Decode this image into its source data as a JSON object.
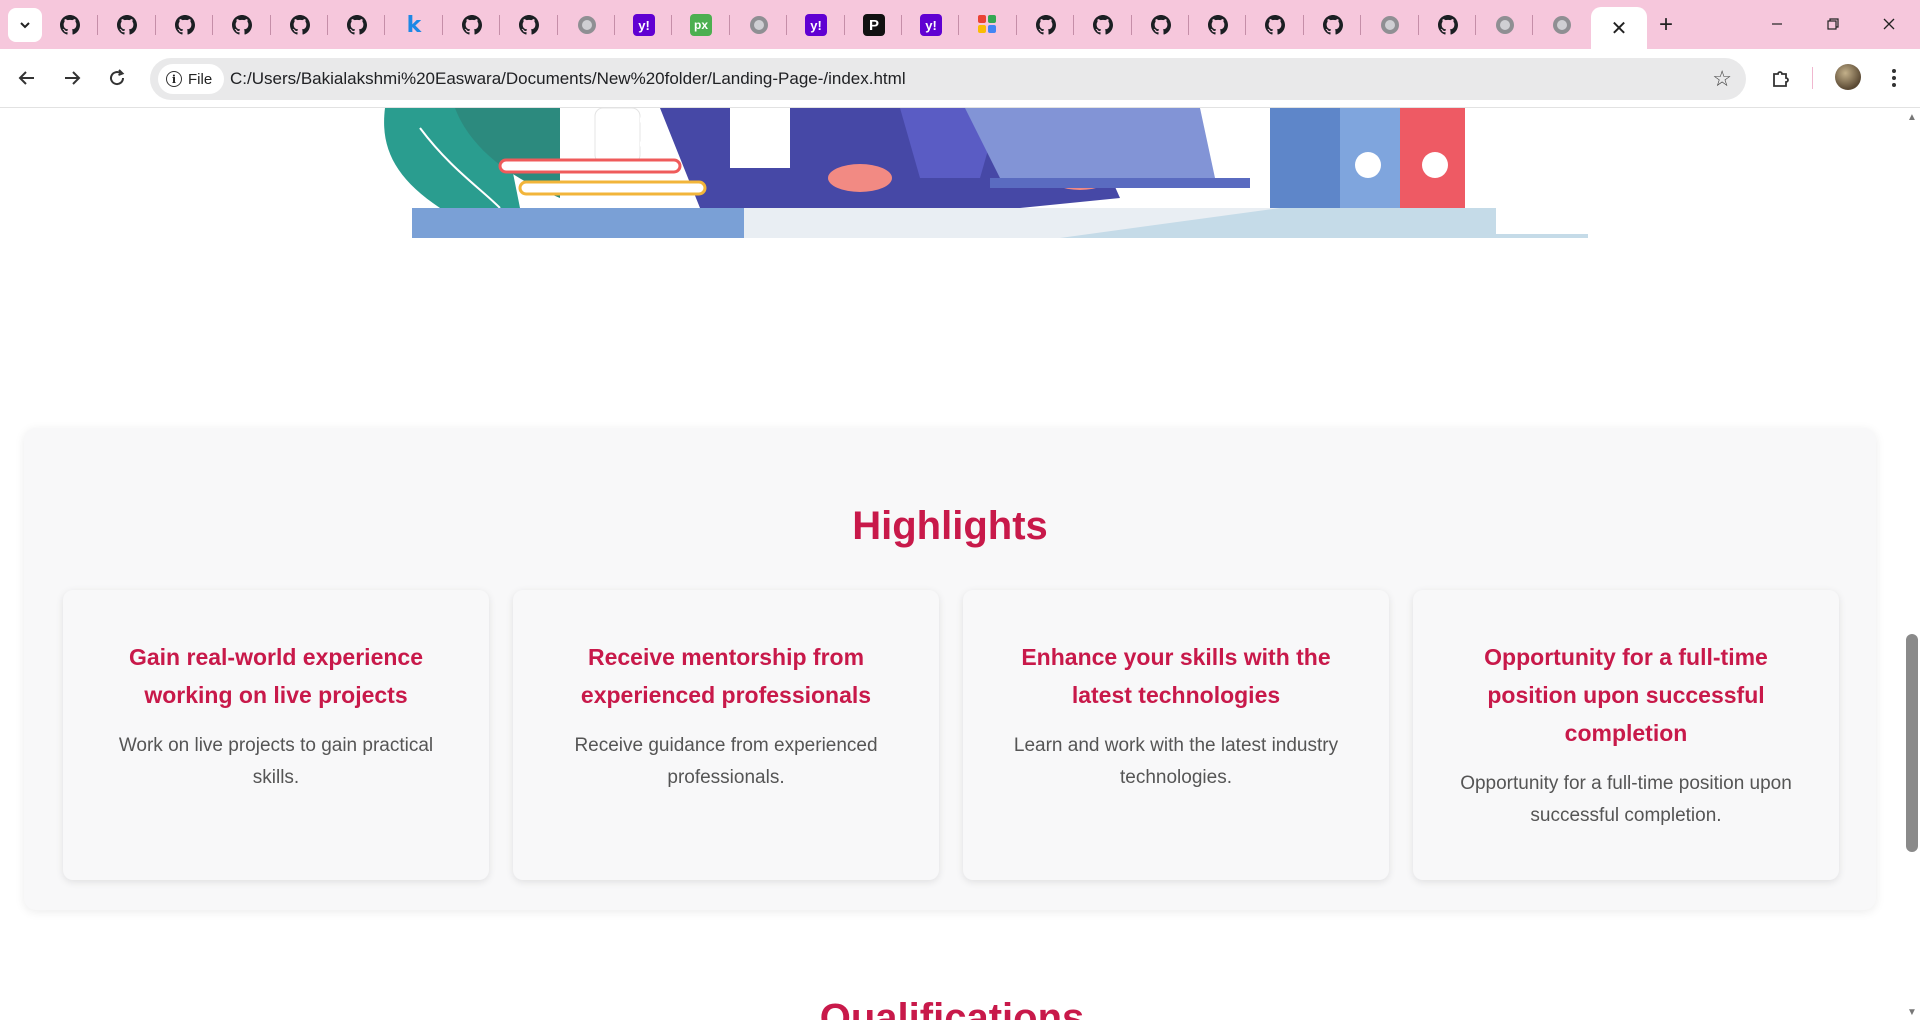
{
  "browser": {
    "tabs": [
      {
        "icon": "github-icon"
      },
      {
        "icon": "github-icon"
      },
      {
        "icon": "github-icon"
      },
      {
        "icon": "github-icon"
      },
      {
        "icon": "github-icon"
      },
      {
        "icon": "github-icon"
      },
      {
        "icon": "k-icon",
        "glyph": "k"
      },
      {
        "icon": "github-icon"
      },
      {
        "icon": "github-icon"
      },
      {
        "icon": "globe-icon"
      },
      {
        "icon": "yahoo-icon",
        "glyph": "y!"
      },
      {
        "icon": "px-icon",
        "glyph": "px"
      },
      {
        "icon": "globe-icon"
      },
      {
        "icon": "yahoo-icon",
        "glyph": "y!"
      },
      {
        "icon": "p-icon",
        "glyph": "P"
      },
      {
        "icon": "yahoo-icon",
        "glyph": "y!"
      },
      {
        "icon": "pinwheel-icon"
      },
      {
        "icon": "github-icon"
      },
      {
        "icon": "github-icon"
      },
      {
        "icon": "github-icon"
      },
      {
        "icon": "github-icon"
      },
      {
        "icon": "github-icon"
      },
      {
        "icon": "github-icon"
      },
      {
        "icon": "globe-icon"
      },
      {
        "icon": "github-icon"
      },
      {
        "icon": "globe-icon"
      },
      {
        "icon": "globe-icon"
      }
    ],
    "close_glyph": "✕",
    "new_tab_glyph": "+",
    "security_chip": "File",
    "url": "C:/Users/Bakialakshmi%20Easwara/Documents/New%20folder/Landing-Page-/index.html"
  },
  "highlights": {
    "title": "Highlights",
    "cards": [
      {
        "title": "Gain real-world experience working on live projects",
        "desc": "Work on live projects to gain practical skills."
      },
      {
        "title": "Receive mentorship from experienced professionals",
        "desc": "Receive guidance from experienced professionals."
      },
      {
        "title": "Enhance your skills with the latest technologies",
        "desc": "Learn and work with the latest industry technologies."
      },
      {
        "title": "Opportunity for a full-time position upon successful completion",
        "desc": "Opportunity for a full-time position upon successful completion."
      }
    ]
  },
  "next_section_title": "Qualifications",
  "colors": {
    "accent": "#c8194a",
    "tabstrip": "#f6c7dc"
  }
}
